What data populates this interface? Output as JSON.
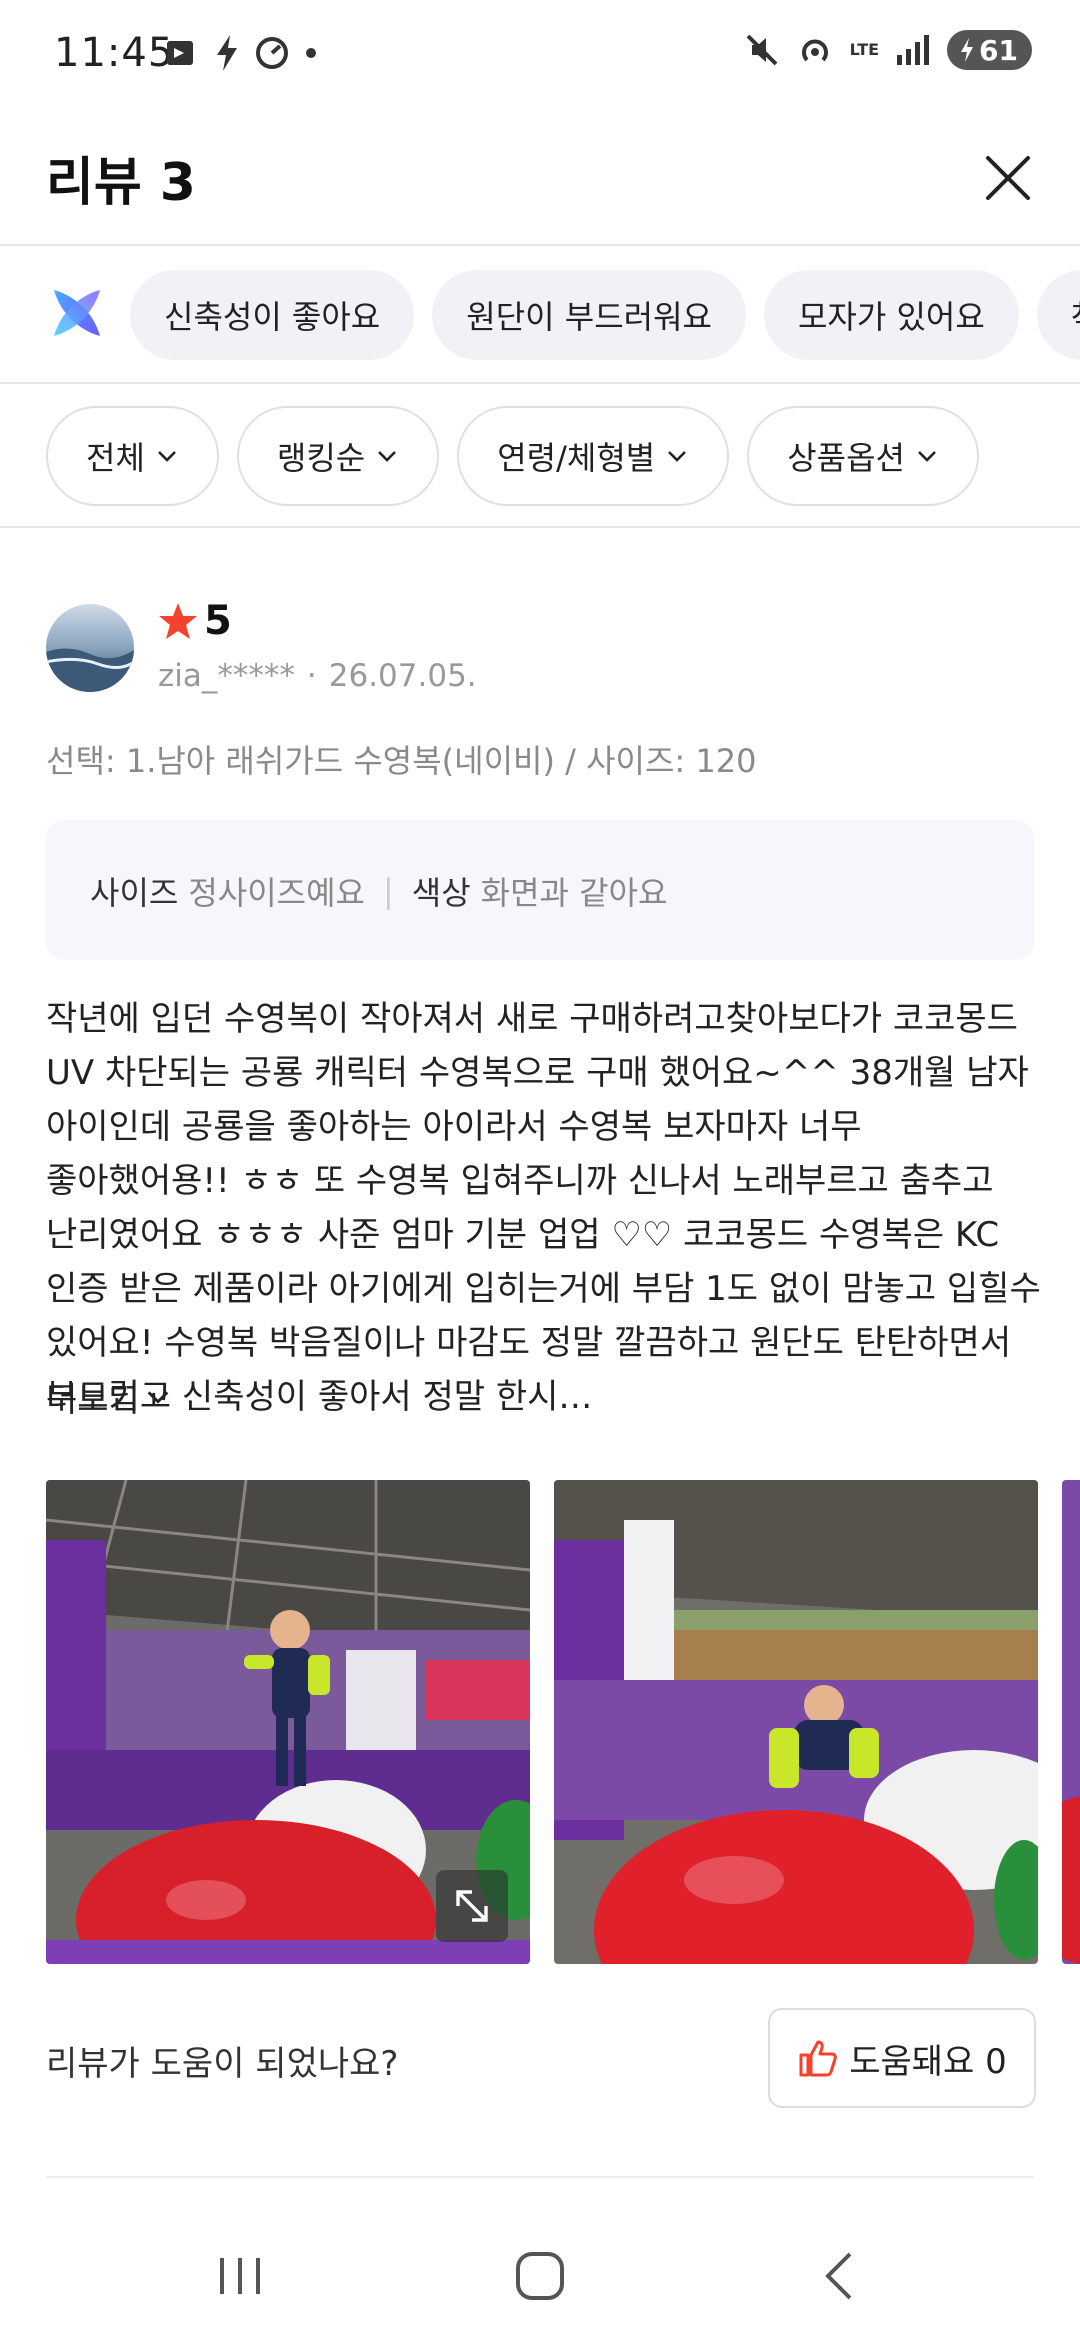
{
  "status_bar": {
    "time": "11:45",
    "battery": "61",
    "network": "LTE"
  },
  "header": {
    "title": "리뷰 3",
    "close_icon": "close-icon"
  },
  "keywords": [
    "신축성이 좋아요",
    "원단이 부드러워요",
    "모자가 있어요",
    "착용이"
  ],
  "filters": [
    {
      "label": "전체"
    },
    {
      "label": "랭킹순"
    },
    {
      "label": "연령/체형별"
    },
    {
      "label": "상품옵션"
    }
  ],
  "review": {
    "rating": "5",
    "user": "zia_*****",
    "date": "26.07.05.",
    "option": "선택: 1.남아 래쉬가드 수영복(네이비) / 사이즈: 120",
    "attributes": [
      {
        "key": "사이즈",
        "value": "정사이즈예요"
      },
      {
        "key": "색상",
        "value": "화면과 같아요"
      }
    ],
    "body": "작년에 입던 수영복이 작아져서 새로 구매하려고찾아보다가 코코몽드 UV 차단되는 공룡 캐릭터 수영복으로 구매 했어요~^^ 38개월 남자 아이인데 공룡을 좋아하는 아이라서 수영복 보자마자 너무 좋아했어용!! ㅎㅎ 또 수영복 입혀주니까 신나서 노래부르고 춤추고 난리였어요 ㅎㅎㅎ 사준 엄마 기분 업업 ♡♡  코코몽드 수영복은 KC 인증 받은 제품이라 아기에게 입히는거에 부담 1도 없이 맘놓고 입힐수 있어요! 수영복 박음질이나 마감도 정말 깔끔하고 원단도 탄탄하면서 부드럽고 신축성이 좋아서 정말 한시…",
    "more_label": "더보기",
    "helpful_question": "리뷰가 도움이 되었나요?",
    "helpful_label": "도움돼요 0"
  },
  "colors": {
    "star": "#f5412d",
    "helpful_icon": "#f5412d",
    "chip_bg": "#f0f2f5"
  }
}
